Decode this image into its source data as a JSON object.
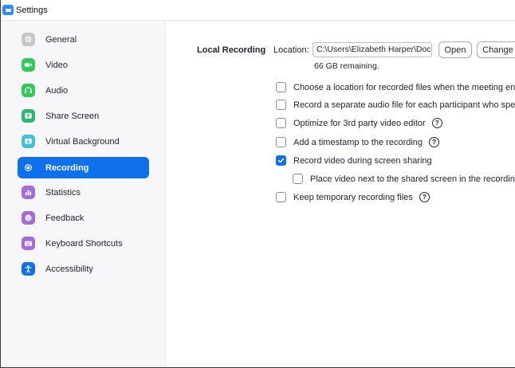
{
  "window": {
    "title": "Settings"
  },
  "sidebar": {
    "items": [
      {
        "label": "General",
        "icon": "gear-icon",
        "color": "#c7c7cc",
        "active": false
      },
      {
        "label": "Video",
        "icon": "video-camera-icon",
        "color": "#34c759",
        "active": false
      },
      {
        "label": "Audio",
        "icon": "headphones-icon",
        "color": "#34c759",
        "active": false
      },
      {
        "label": "Share Screen",
        "icon": "share-screen-icon",
        "color": "#2bb673",
        "active": false
      },
      {
        "label": "Virtual Background",
        "icon": "virtual-background-icon",
        "color": "#3ec1d3",
        "active": false
      },
      {
        "label": "Recording",
        "icon": "record-icon",
        "color": "#0e71eb",
        "active": true
      },
      {
        "label": "Statistics",
        "icon": "bar-chart-icon",
        "color": "#a36cd8",
        "active": false
      },
      {
        "label": "Feedback",
        "icon": "smiley-icon",
        "color": "#a36cd8",
        "active": false
      },
      {
        "label": "Keyboard Shortcuts",
        "icon": "keyboard-icon",
        "color": "#a36cd8",
        "active": false
      },
      {
        "label": "Accessibility",
        "icon": "accessibility-icon",
        "color": "#0e71eb",
        "active": false
      }
    ]
  },
  "recording": {
    "section_title": "Local Recording",
    "location_label": "Location:",
    "location_value": "C:\\Users\\Elizabeth Harper\\Documents\\Zoom",
    "open_label": "Open",
    "change_label": "Change",
    "remaining": "66 GB remaining.",
    "options": [
      {
        "label": "Choose a location for recorded files when the meeting ends",
        "checked": false,
        "help": false,
        "indent": false
      },
      {
        "label": "Record a separate audio file for each participant who speaks",
        "checked": false,
        "help": false,
        "indent": false
      },
      {
        "label": "Optimize for 3rd party video editor",
        "checked": false,
        "help": true,
        "indent": false
      },
      {
        "label": "Add a timestamp to the recording",
        "checked": false,
        "help": true,
        "indent": false
      },
      {
        "label": "Record video during screen sharing",
        "checked": true,
        "help": false,
        "indent": false
      },
      {
        "label": "Place video next to the shared screen in the recording",
        "checked": false,
        "help": false,
        "indent": true
      },
      {
        "label": "Keep temporary recording files",
        "checked": false,
        "help": true,
        "indent": false
      }
    ],
    "help_glyph": "?"
  }
}
